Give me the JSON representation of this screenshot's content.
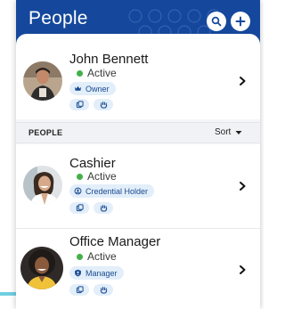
{
  "header": {
    "title": "People",
    "search_icon": "search-icon",
    "add_icon": "add-icon"
  },
  "current_user": {
    "name": "John Bennett",
    "status": "Active",
    "role": "Owner",
    "role_icon": "crown-icon",
    "mini_icons": [
      "badge-icon",
      "hand-icon"
    ]
  },
  "section": {
    "label": "PEOPLE",
    "sort_label": "Sort"
  },
  "people": [
    {
      "name": "Cashier",
      "status": "Active",
      "role": "Credential Holder",
      "role_icon": "credential-icon",
      "mini_icons": [
        "badge-icon",
        "hand-icon"
      ]
    },
    {
      "name": "Office Manager",
      "status": "Active",
      "role": "Manager",
      "role_icon": "manager-icon",
      "mini_icons": [
        "badge-icon",
        "hand-icon"
      ]
    }
  ],
  "colors": {
    "header": "#15489c",
    "chip_bg": "#e2eef9",
    "chip_text": "#1a4a91",
    "active_dot": "#43b049"
  }
}
